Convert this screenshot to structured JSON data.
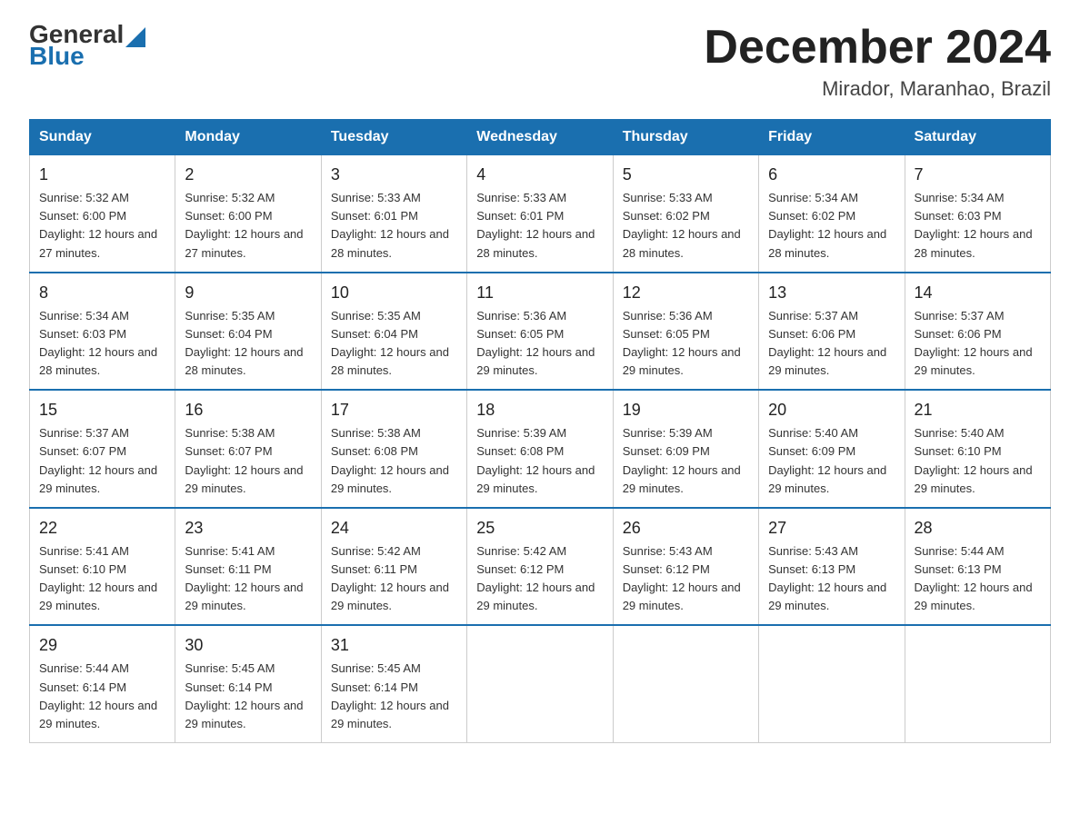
{
  "header": {
    "logo_general": "General",
    "logo_blue": "Blue",
    "month_title": "December 2024",
    "location": "Mirador, Maranhao, Brazil"
  },
  "weekdays": [
    "Sunday",
    "Monday",
    "Tuesday",
    "Wednesday",
    "Thursday",
    "Friday",
    "Saturday"
  ],
  "weeks": [
    [
      {
        "day": "1",
        "sunrise": "5:32 AM",
        "sunset": "6:00 PM",
        "daylight": "12 hours and 27 minutes."
      },
      {
        "day": "2",
        "sunrise": "5:32 AM",
        "sunset": "6:00 PM",
        "daylight": "12 hours and 27 minutes."
      },
      {
        "day": "3",
        "sunrise": "5:33 AM",
        "sunset": "6:01 PM",
        "daylight": "12 hours and 28 minutes."
      },
      {
        "day": "4",
        "sunrise": "5:33 AM",
        "sunset": "6:01 PM",
        "daylight": "12 hours and 28 minutes."
      },
      {
        "day": "5",
        "sunrise": "5:33 AM",
        "sunset": "6:02 PM",
        "daylight": "12 hours and 28 minutes."
      },
      {
        "day": "6",
        "sunrise": "5:34 AM",
        "sunset": "6:02 PM",
        "daylight": "12 hours and 28 minutes."
      },
      {
        "day": "7",
        "sunrise": "5:34 AM",
        "sunset": "6:03 PM",
        "daylight": "12 hours and 28 minutes."
      }
    ],
    [
      {
        "day": "8",
        "sunrise": "5:34 AM",
        "sunset": "6:03 PM",
        "daylight": "12 hours and 28 minutes."
      },
      {
        "day": "9",
        "sunrise": "5:35 AM",
        "sunset": "6:04 PM",
        "daylight": "12 hours and 28 minutes."
      },
      {
        "day": "10",
        "sunrise": "5:35 AM",
        "sunset": "6:04 PM",
        "daylight": "12 hours and 28 minutes."
      },
      {
        "day": "11",
        "sunrise": "5:36 AM",
        "sunset": "6:05 PM",
        "daylight": "12 hours and 29 minutes."
      },
      {
        "day": "12",
        "sunrise": "5:36 AM",
        "sunset": "6:05 PM",
        "daylight": "12 hours and 29 minutes."
      },
      {
        "day": "13",
        "sunrise": "5:37 AM",
        "sunset": "6:06 PM",
        "daylight": "12 hours and 29 minutes."
      },
      {
        "day": "14",
        "sunrise": "5:37 AM",
        "sunset": "6:06 PM",
        "daylight": "12 hours and 29 minutes."
      }
    ],
    [
      {
        "day": "15",
        "sunrise": "5:37 AM",
        "sunset": "6:07 PM",
        "daylight": "12 hours and 29 minutes."
      },
      {
        "day": "16",
        "sunrise": "5:38 AM",
        "sunset": "6:07 PM",
        "daylight": "12 hours and 29 minutes."
      },
      {
        "day": "17",
        "sunrise": "5:38 AM",
        "sunset": "6:08 PM",
        "daylight": "12 hours and 29 minutes."
      },
      {
        "day": "18",
        "sunrise": "5:39 AM",
        "sunset": "6:08 PM",
        "daylight": "12 hours and 29 minutes."
      },
      {
        "day": "19",
        "sunrise": "5:39 AM",
        "sunset": "6:09 PM",
        "daylight": "12 hours and 29 minutes."
      },
      {
        "day": "20",
        "sunrise": "5:40 AM",
        "sunset": "6:09 PM",
        "daylight": "12 hours and 29 minutes."
      },
      {
        "day": "21",
        "sunrise": "5:40 AM",
        "sunset": "6:10 PM",
        "daylight": "12 hours and 29 minutes."
      }
    ],
    [
      {
        "day": "22",
        "sunrise": "5:41 AM",
        "sunset": "6:10 PM",
        "daylight": "12 hours and 29 minutes."
      },
      {
        "day": "23",
        "sunrise": "5:41 AM",
        "sunset": "6:11 PM",
        "daylight": "12 hours and 29 minutes."
      },
      {
        "day": "24",
        "sunrise": "5:42 AM",
        "sunset": "6:11 PM",
        "daylight": "12 hours and 29 minutes."
      },
      {
        "day": "25",
        "sunrise": "5:42 AM",
        "sunset": "6:12 PM",
        "daylight": "12 hours and 29 minutes."
      },
      {
        "day": "26",
        "sunrise": "5:43 AM",
        "sunset": "6:12 PM",
        "daylight": "12 hours and 29 minutes."
      },
      {
        "day": "27",
        "sunrise": "5:43 AM",
        "sunset": "6:13 PM",
        "daylight": "12 hours and 29 minutes."
      },
      {
        "day": "28",
        "sunrise": "5:44 AM",
        "sunset": "6:13 PM",
        "daylight": "12 hours and 29 minutes."
      }
    ],
    [
      {
        "day": "29",
        "sunrise": "5:44 AM",
        "sunset": "6:14 PM",
        "daylight": "12 hours and 29 minutes."
      },
      {
        "day": "30",
        "sunrise": "5:45 AM",
        "sunset": "6:14 PM",
        "daylight": "12 hours and 29 minutes."
      },
      {
        "day": "31",
        "sunrise": "5:45 AM",
        "sunset": "6:14 PM",
        "daylight": "12 hours and 29 minutes."
      },
      null,
      null,
      null,
      null
    ]
  ]
}
